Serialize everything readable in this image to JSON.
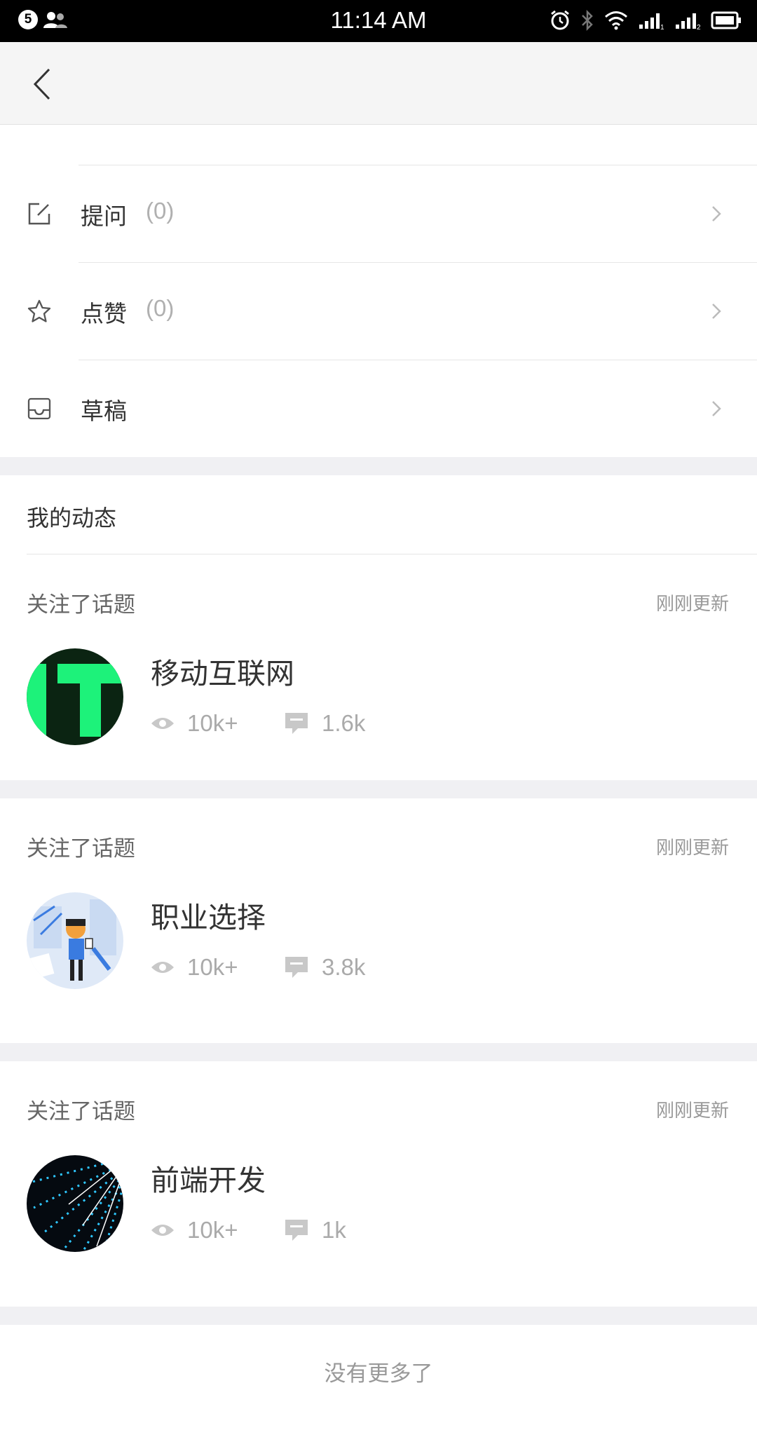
{
  "status_bar": {
    "time": "11:14 AM",
    "notification_count": "5",
    "left_icons": [
      "notification-count-icon",
      "contacts-icon"
    ],
    "right_icons": [
      "alarm-icon",
      "bluetooth-icon",
      "wifi-icon",
      "signal-sim1-icon",
      "signal-sim2-icon",
      "battery-icon"
    ]
  },
  "nav": {
    "back_icon": "chevron-left-icon"
  },
  "menu": {
    "items": [
      {
        "label": "提问",
        "count": "(0)",
        "icon": "edit-square-icon"
      },
      {
        "label": "点赞",
        "count": "(0)",
        "icon": "star-icon"
      },
      {
        "label": "草稿",
        "count": "",
        "icon": "inbox-tray-icon"
      }
    ]
  },
  "activity": {
    "title": "我的动态",
    "cards": [
      {
        "type": "关注了话题",
        "time": "刚刚更新",
        "topic": "移动互联网",
        "views": "10k+",
        "comments": "1.6k"
      },
      {
        "type": "关注了话题",
        "time": "刚刚更新",
        "topic": "职业选择",
        "views": "10k+",
        "comments": "3.8k"
      },
      {
        "type": "关注了话题",
        "time": "刚刚更新",
        "topic": "前端开发",
        "views": "10k+",
        "comments": "1k"
      }
    ],
    "end_text": "没有更多了"
  },
  "colors": {
    "nav_bg": "#f5f5f5",
    "gap_bg": "#f0f0f3",
    "muted_text": "#999999",
    "icon_gray": "#c8c8c8"
  }
}
